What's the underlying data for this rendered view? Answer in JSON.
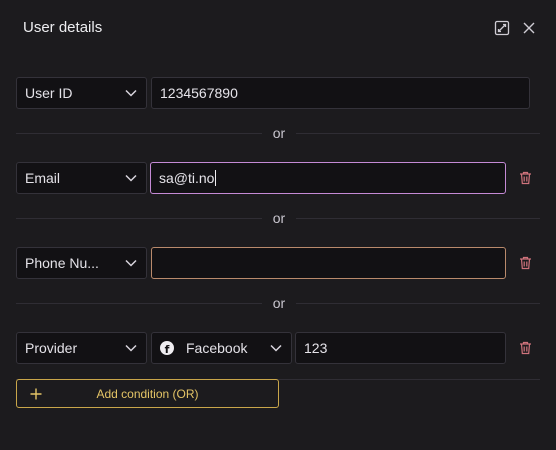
{
  "header": {
    "title": "User details"
  },
  "conditions": [
    {
      "field": "User ID",
      "value": "1234567890",
      "deletable": false
    },
    {
      "field": "Email",
      "value": "sa@ti.no",
      "focused": true
    },
    {
      "field": "Phone Nu...",
      "value": "",
      "invalid": true
    },
    {
      "field": "Provider",
      "provider": "Facebook",
      "value": "123"
    }
  ],
  "separator_label": "or",
  "add_button_label": "Add condition (OR)",
  "colors": {
    "background": "#1c1b1e",
    "focus_border": "#c58ad6",
    "warning_border": "#b98a6c",
    "delete_icon": "#d0737c",
    "add_button": "#e4c466"
  },
  "icons": {
    "expand": "expand-icon",
    "close": "close-icon",
    "chevron": "chevron-down-icon",
    "delete": "trash-icon",
    "provider": "facebook-icon",
    "add": "plus-icon"
  }
}
